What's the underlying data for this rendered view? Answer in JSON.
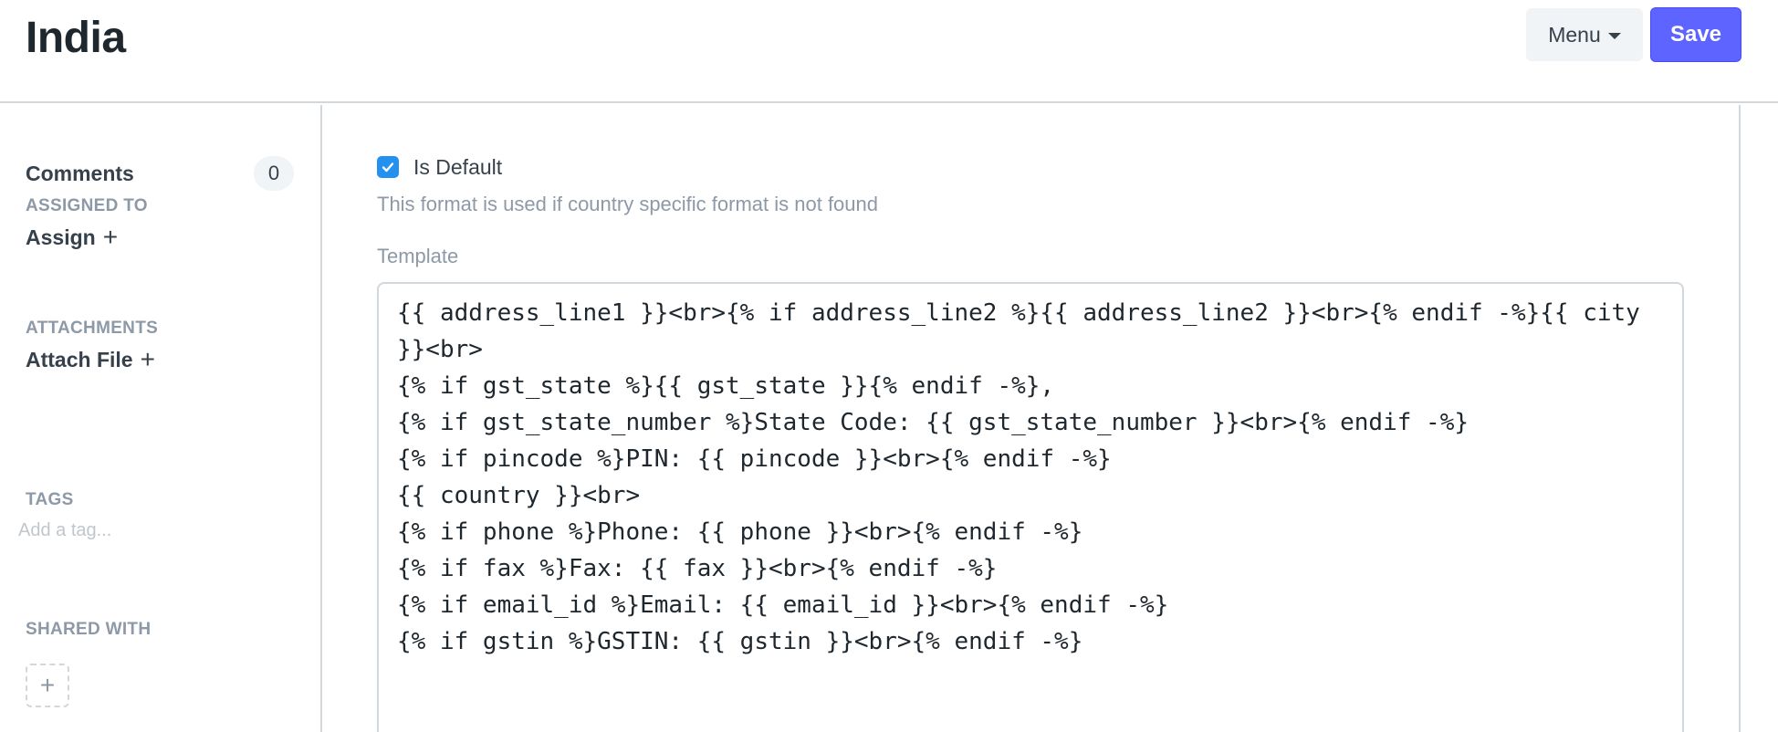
{
  "header": {
    "title": "India",
    "menu_label": "Menu",
    "save_label": "Save"
  },
  "sidebar": {
    "comments_label": "Comments",
    "comments_count": "0",
    "assigned_heading": "ASSIGNED TO",
    "assign_label": "Assign",
    "attachments_heading": "ATTACHMENTS",
    "attach_label": "Attach File",
    "tags_heading": "TAGS",
    "tag_placeholder": "Add a tag...",
    "shared_heading": "SHARED WITH"
  },
  "form": {
    "is_default_label": "Is Default",
    "is_default_checked": true,
    "is_default_help": "This format is used if country specific format is not found",
    "template_label": "Template",
    "template_value": "{{ address_line1 }}<br>{% if address_line2 %}{{ address_line2 }}<br>{% endif -%}{{ city }}<br>\n{% if gst_state %}{{ gst_state }}{% endif -%},\n{% if gst_state_number %}State Code: {{ gst_state_number }}<br>{% endif -%}\n{% if pincode %}PIN: {{ pincode }}<br>{% endif -%}\n{{ country }}<br>\n{% if phone %}Phone: {{ phone }}<br>{% endif -%}\n{% if fax %}Fax: {{ fax }}<br>{% endif -%}\n{% if email_id %}Email: {{ email_id }}<br>{% endif -%}\n{% if gstin %}GSTIN: {{ gstin }}<br>{% endif -%}"
  },
  "colors": {
    "primary": "#5e64ff",
    "checkbox": "#2490ef",
    "muted_text": "#8d99a6",
    "border": "#d1d8dd"
  },
  "icons": {
    "caret": "chevron-down-icon",
    "check": "check-icon",
    "plus": "plus-icon"
  }
}
